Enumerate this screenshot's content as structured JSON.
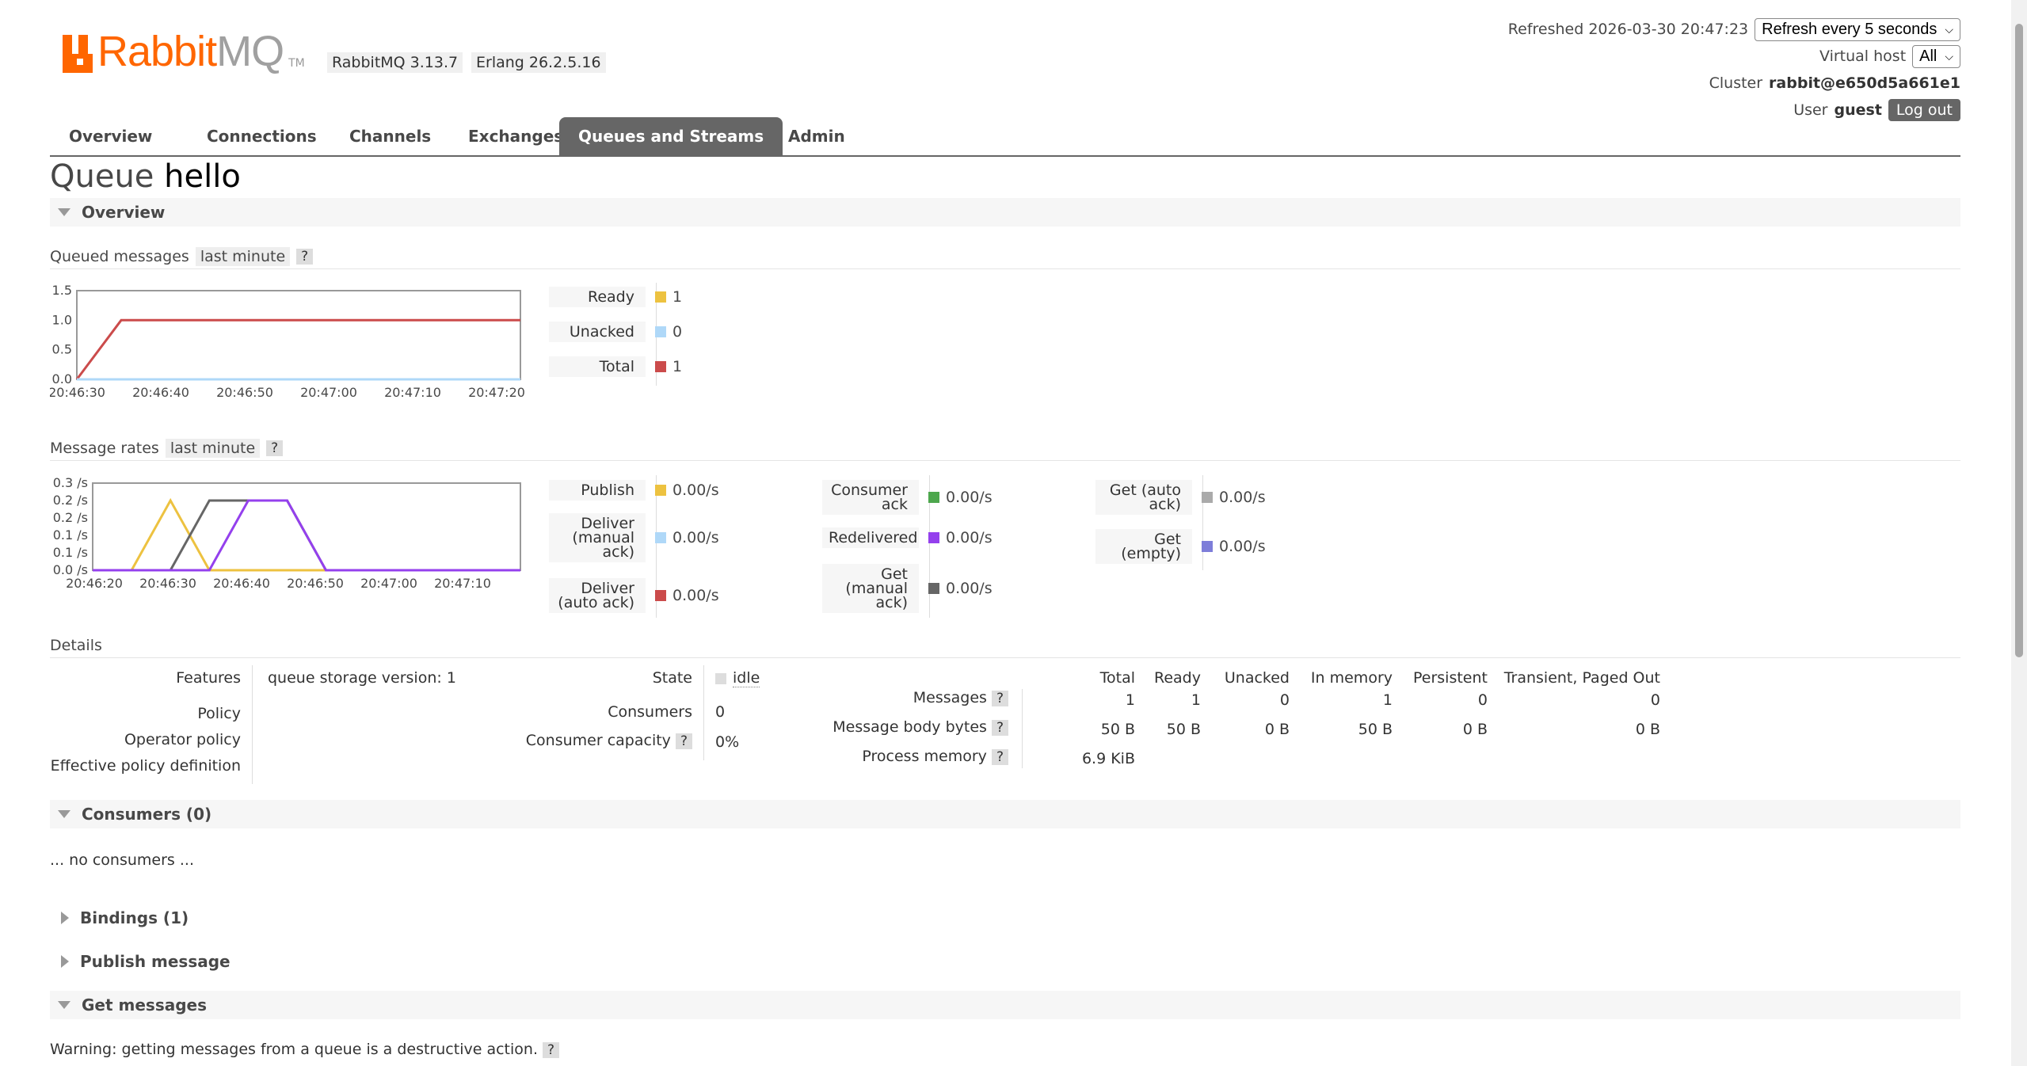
{
  "header": {
    "logo_text_rabbit": "Rabbit",
    "logo_text_mq": "MQ",
    "logo_tm": "TM",
    "rabbitmq_version": "RabbitMQ 3.13.7",
    "erlang_version": "Erlang 26.2.5.16",
    "refreshed": "Refreshed 2026-03-30 20:47:23",
    "refresh_select": "Refresh every 5 seconds",
    "vhost_label": "Virtual host",
    "vhost_select": "All",
    "cluster_label": "Cluster",
    "cluster_name": "rabbit@e650d5a661e1",
    "user_label": "User",
    "user_name": "guest",
    "logout": "Log out"
  },
  "tabs": [
    "Overview",
    "Connections",
    "Channels",
    "Exchanges",
    "Queues and Streams",
    "Admin"
  ],
  "title": {
    "prefix": "Queue",
    "name": "hello"
  },
  "sections": {
    "overview": "Overview",
    "consumers": "Consumers (0)",
    "bindings": "Bindings (1)",
    "publish": "Publish message",
    "get": "Get messages"
  },
  "queued": {
    "label": "Queued messages",
    "range": "last minute",
    "help": "?",
    "legend": [
      {
        "label": "Ready",
        "value": "1",
        "color": "#edc240"
      },
      {
        "label": "Unacked",
        "value": "0",
        "color": "#afd8f8"
      },
      {
        "label": "Total",
        "value": "1",
        "color": "#cb4b4b"
      }
    ]
  },
  "rates": {
    "label": "Message rates",
    "range": "last minute",
    "help": "?",
    "col1": [
      {
        "label": "Publish",
        "value": "0.00/s",
        "color": "#edc240"
      },
      {
        "label": "Deliver\n(manual\nack)",
        "value": "0.00/s",
        "color": "#afd8f8"
      },
      {
        "label": "Deliver\n(auto ack)",
        "value": "0.00/s",
        "color": "#cb4b4b"
      }
    ],
    "col2": [
      {
        "label": "Consumer\nack",
        "value": "0.00/s",
        "color": "#4da74d"
      },
      {
        "label": "Redelivered",
        "value": "0.00/s",
        "color": "#9440ed"
      },
      {
        "label": "Get\n(manual\nack)",
        "value": "0.00/s",
        "color": "#666666"
      }
    ],
    "col3": [
      {
        "label": "Get (auto\nack)",
        "value": "0.00/s",
        "color": "#aaaaaa"
      },
      {
        "label": "Get\n(empty)",
        "value": "0.00/s",
        "color": "#7d7dd9"
      }
    ]
  },
  "chart_data": [
    {
      "type": "line",
      "x": [
        "20:46:30",
        "20:46:40",
        "20:46:50",
        "20:47:00",
        "20:47:10",
        "20:47:20"
      ],
      "ylim": [
        0,
        1.5
      ],
      "yticks": [
        "1.5",
        "1.0",
        "0.5",
        "0.0"
      ],
      "series": [
        {
          "name": "Total",
          "color": "#cb4b4b",
          "points": [
            [
              0,
              0
            ],
            [
              5,
              1
            ],
            [
              50,
              1
            ]
          ]
        },
        {
          "name": "Unacked",
          "color": "#afd8f8",
          "points": [
            [
              0,
              0
            ],
            [
              50,
              0
            ]
          ]
        }
      ]
    },
    {
      "type": "line",
      "x": [
        "20:46:20",
        "20:46:30",
        "20:46:40",
        "20:46:50",
        "20:47:00",
        "20:47:10"
      ],
      "ylim": [
        0,
        0.25
      ],
      "yticks": [
        "0.3 /s",
        "0.2 /s",
        "0.2 /s",
        "0.1 /s",
        "0.1 /s",
        "0.0 /s"
      ],
      "series": [
        {
          "name": "Publish",
          "color": "#edc240",
          "points": [
            [
              0,
              0
            ],
            [
              5,
              0
            ],
            [
              10,
              0.2
            ],
            [
              15,
              0
            ],
            [
              55,
              0
            ]
          ]
        },
        {
          "name": "Get (manual ack)",
          "color": "#666666",
          "points": [
            [
              0,
              0
            ],
            [
              10,
              0
            ],
            [
              15,
              0.2
            ],
            [
              25,
              0.2
            ],
            [
              30,
              0
            ],
            [
              55,
              0
            ]
          ]
        },
        {
          "name": "Redelivered",
          "color": "#9440ed",
          "points": [
            [
              0,
              0
            ],
            [
              15,
              0
            ],
            [
              20,
              0.2
            ],
            [
              25,
              0.2
            ],
            [
              30,
              0
            ],
            [
              55,
              0
            ]
          ]
        }
      ]
    }
  ],
  "details": {
    "label": "Details",
    "features_label": "Features",
    "features_key": "queue storage version:",
    "features_val": "1",
    "policy_label": "Policy",
    "operator_policy_label": "Operator policy",
    "effective_policy_label": "Effective policy definition",
    "state_label": "State",
    "state_val": "idle",
    "consumers_label": "Consumers",
    "consumers_val": "0",
    "capacity_label": "Consumer capacity",
    "capacity_val": "0%",
    "help": "?",
    "mtable": {
      "cols": [
        "Total",
        "Ready",
        "Unacked",
        "In memory",
        "Persistent",
        "Transient, Paged Out"
      ],
      "rows": [
        {
          "label": "Messages",
          "vals": [
            "1",
            "1",
            "0",
            "1",
            "0",
            "0"
          ]
        },
        {
          "label": "Message body bytes",
          "vals": [
            "50 B",
            "50 B",
            "0 B",
            "50 B",
            "0 B",
            "0 B"
          ]
        },
        {
          "label": "Process memory",
          "vals": [
            "6.9 KiB"
          ]
        }
      ]
    }
  },
  "no_consumers": "... no consumers ...",
  "warning": "Warning: getting messages from a queue is a destructive action.",
  "warning_help": "?"
}
